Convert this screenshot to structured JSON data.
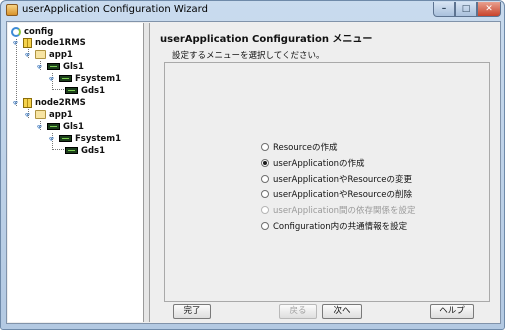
{
  "window": {
    "title": "userApplication Configuration Wizard",
    "controls": {
      "minimize": "–",
      "maximize": "□",
      "close": "✕"
    }
  },
  "tree": {
    "root": "config",
    "nodes": [
      {
        "label": "node1RMS",
        "app": "app1",
        "gls": "Gls1",
        "fsystem": "Fsystem1",
        "gds": "Gds1"
      },
      {
        "label": "node2RMS",
        "app": "app1",
        "gls": "Gls1",
        "fsystem": "Fsystem1",
        "gds": "Gds1"
      }
    ],
    "expander_symbol": "ዋ"
  },
  "panel": {
    "title": "userApplication Configuration メニュー",
    "subtitle": "設定するメニューを選択してください。",
    "options": [
      {
        "label": "Resourceの作成",
        "selected": false,
        "enabled": true
      },
      {
        "label": "userApplicationの作成",
        "selected": true,
        "enabled": true
      },
      {
        "label": "userApplicationやResourceの変更",
        "selected": false,
        "enabled": true
      },
      {
        "label": "userApplicationやResourceの削除",
        "selected": false,
        "enabled": true
      },
      {
        "label": "userApplication間の依存関係を設定",
        "selected": false,
        "enabled": false
      },
      {
        "label": "Configuration内の共通情報を設定",
        "selected": false,
        "enabled": true
      }
    ]
  },
  "buttons": {
    "finish": "完了",
    "back": "戻る",
    "next": "次へ",
    "help": "ヘルプ"
  }
}
